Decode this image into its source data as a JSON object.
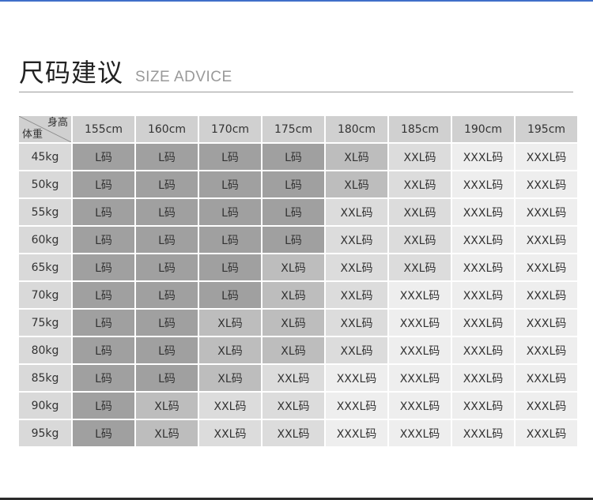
{
  "header": {
    "title_cn": "尺码建议",
    "title_en": "SIZE ADVICE"
  },
  "table": {
    "corner_height_label": "身高",
    "corner_weight_label": "体重",
    "heights": [
      "155cm",
      "160cm",
      "170cm",
      "175cm",
      "180cm",
      "185cm",
      "190cm",
      "195cm"
    ],
    "rows": [
      {
        "weight": "45kg",
        "sizes": [
          "L码",
          "L码",
          "L码",
          "L码",
          "XL码",
          "XXL码",
          "XXXL码",
          "XXXL码"
        ]
      },
      {
        "weight": "50kg",
        "sizes": [
          "L码",
          "L码",
          "L码",
          "L码",
          "XL码",
          "XXL码",
          "XXXL码",
          "XXXL码"
        ]
      },
      {
        "weight": "55kg",
        "sizes": [
          "L码",
          "L码",
          "L码",
          "L码",
          "XXL码",
          "XXL码",
          "XXXL码",
          "XXXL码"
        ]
      },
      {
        "weight": "60kg",
        "sizes": [
          "L码",
          "L码",
          "L码",
          "L码",
          "XXL码",
          "XXL码",
          "XXXL码",
          "XXXL码"
        ]
      },
      {
        "weight": "65kg",
        "sizes": [
          "L码",
          "L码",
          "L码",
          "XL码",
          "XXL码",
          "XXL码",
          "XXXL码",
          "XXXL码"
        ]
      },
      {
        "weight": "70kg",
        "sizes": [
          "L码",
          "L码",
          "L码",
          "XL码",
          "XXL码",
          "XXXL码",
          "XXXL码",
          "XXXL码"
        ]
      },
      {
        "weight": "75kg",
        "sizes": [
          "L码",
          "L码",
          "XL码",
          "XL码",
          "XXL码",
          "XXXL码",
          "XXXL码",
          "XXXL码"
        ]
      },
      {
        "weight": "80kg",
        "sizes": [
          "L码",
          "L码",
          "XL码",
          "XL码",
          "XXL码",
          "XXXL码",
          "XXXL码",
          "XXXL码"
        ]
      },
      {
        "weight": "85kg",
        "sizes": [
          "L码",
          "L码",
          "XL码",
          "XXL码",
          "XXXL码",
          "XXXL码",
          "XXXL码",
          "XXXL码"
        ]
      },
      {
        "weight": "90kg",
        "sizes": [
          "L码",
          "XL码",
          "XXL码",
          "XXL码",
          "XXXL码",
          "XXXL码",
          "XXXL码",
          "XXXL码"
        ]
      },
      {
        "weight": "95kg",
        "sizes": [
          "L码",
          "XL码",
          "XXL码",
          "XXL码",
          "XXXL码",
          "XXXL码",
          "XXXL码",
          "XXXL码"
        ]
      }
    ]
  },
  "colors": {
    "accent_top_line": "#3f6fc9",
    "size_L": "#a0a0a0",
    "size_XL": "#bdbdbd",
    "size_XXL": "#dcdcdc",
    "size_XXXL": "#eeeeee",
    "header_cell": "#d0d0d0"
  }
}
